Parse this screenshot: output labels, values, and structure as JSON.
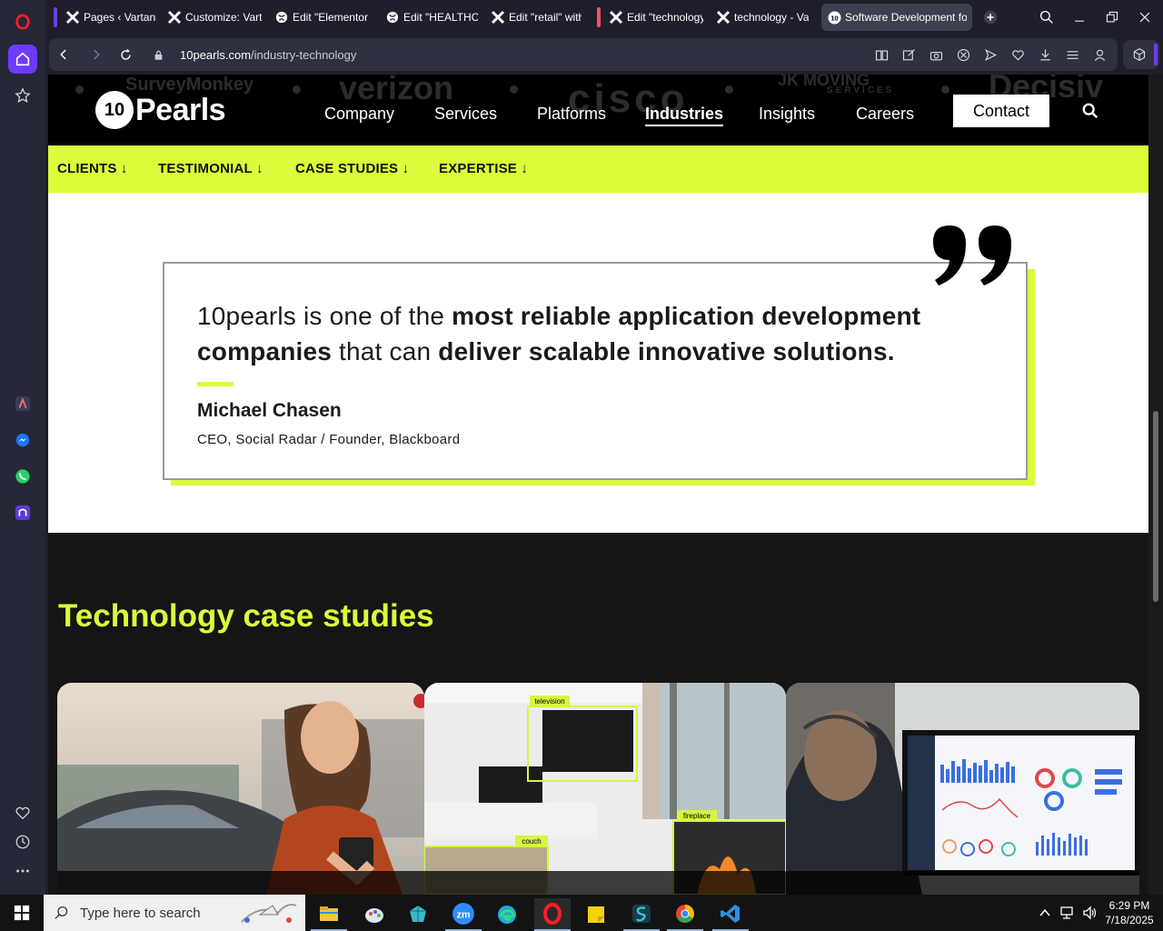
{
  "browser": {
    "tabs": [
      {
        "label": "Pages ‹ Vartanix",
        "icon": "wp-x-icon",
        "group_color": "#6c3bff"
      },
      {
        "label": "Customize: Varta",
        "icon": "wp-x-icon"
      },
      {
        "label": "Edit \"Elementor",
        "icon": "globe-icon"
      },
      {
        "label": "Edit \"HEALTHCA",
        "icon": "globe-icon"
      },
      {
        "label": "Edit \"retail\" with",
        "icon": "wp-x-icon"
      },
      {
        "label": "Edit \"technology",
        "icon": "wp-x-icon",
        "group_color": "#ff4f6d"
      },
      {
        "label": "technology - Va",
        "icon": "wp-x-icon"
      },
      {
        "label": "Software Development for",
        "icon": "10pearls-icon",
        "active": true
      }
    ],
    "url_domain": "10pearls.com",
    "url_path": "/industry-technology"
  },
  "site": {
    "logo_mark": "10",
    "logo_text": "Pearls",
    "ghost_logos": [
      "SurveyMonkey",
      "verizon",
      "cisco",
      "JK MOVING",
      "SERVICES",
      "Decisiv"
    ],
    "nav": [
      {
        "label": "Company"
      },
      {
        "label": "Services"
      },
      {
        "label": "Platforms"
      },
      {
        "label": "Industries",
        "active": true
      },
      {
        "label": "Insights"
      },
      {
        "label": "Careers"
      }
    ],
    "contact_label": "Contact",
    "subnav": [
      "CLIENTS ↓",
      "TESTIMONIAL ↓",
      "CASE STUDIES ↓",
      "EXPERTISE ↓"
    ],
    "accent_color": "#dbfb3b"
  },
  "testimonial": {
    "quote_part1": "10pearls is one of the ",
    "quote_bold1": "most reliable application development companies",
    "quote_part2": " that can ",
    "quote_bold2": "deliver scalable innovative solutions.",
    "name": "Michael Chasen",
    "role": "CEO, Social Radar / Founder, Blackboard"
  },
  "cases": {
    "title": "Technology case studies",
    "cards": [
      {
        "image": "woman-with-phone-by-car"
      },
      {
        "image": "living-room-object-detection",
        "tags": [
          "television",
          "couch",
          "fireplace"
        ]
      },
      {
        "image": "man-viewing-analytics-dashboard"
      }
    ]
  },
  "taskbar": {
    "search_placeholder": "Type here to search",
    "time": "6:29 PM",
    "date": "7/18/2025"
  }
}
